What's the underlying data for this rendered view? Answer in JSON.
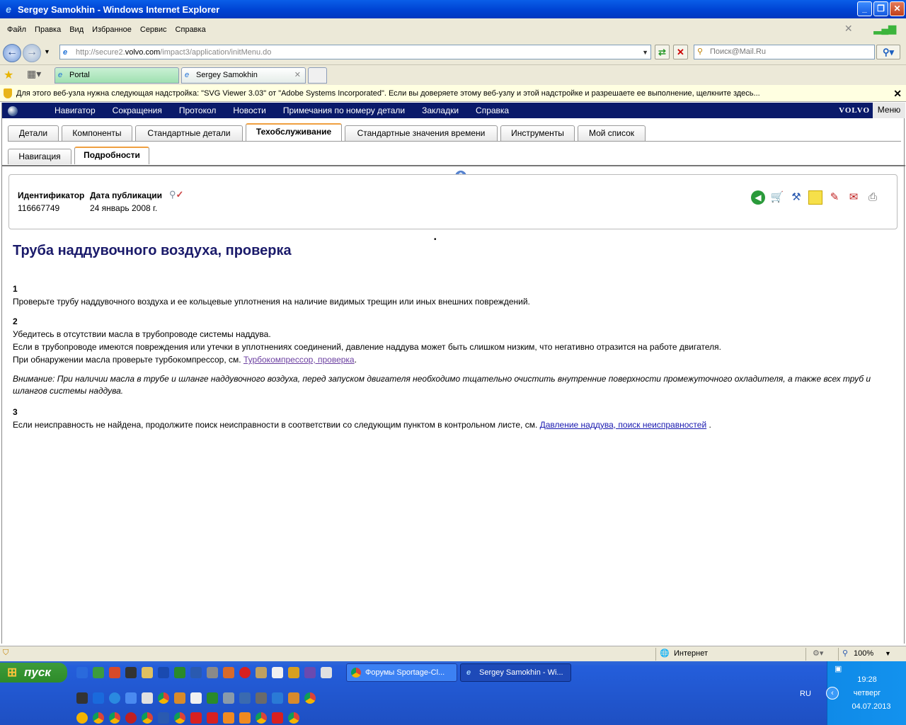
{
  "window": {
    "title": "Sergey Samokhin - Windows Internet Explorer"
  },
  "menu": [
    "Файл",
    "Правка",
    "Вид",
    "Избранное",
    "Сервис",
    "Справка"
  ],
  "address": {
    "prefix": "http://secure2.",
    "host": "volvo.com",
    "path": "/impact3/application/initMenu.do"
  },
  "search": {
    "placeholder": "Поиск@Mail.Ru"
  },
  "browser_tabs": [
    {
      "label": "Portal"
    },
    {
      "label": "Sergey Samokhin"
    }
  ],
  "infobar": {
    "text": "Для этого веб-узла нужна следующая надстройка: \"SVG Viewer 3.03\" от \"Adobe Systems Incorporated\". Если вы доверяете этому веб-узлу и этой надстройке и разрешаете ее выполнение, щелкните здесь..."
  },
  "vnav": {
    "items": [
      "Навигатор",
      "Сокращения",
      "Протокол",
      "Новости",
      "Примечания по номеру детали",
      "Закладки",
      "Справка"
    ],
    "brand": "VOLVO",
    "menu_label": "Меню"
  },
  "tabs_main": [
    "Детали",
    "Компоненты",
    "Стандартные детали",
    "Техобслуживание",
    "Стандартные значения времени",
    "Инструменты",
    "Мой список"
  ],
  "tabs_sub": [
    "Навигация",
    "Подробности"
  ],
  "meta": {
    "id_label": "Идентификатор",
    "id_value": "116667749",
    "date_label": "Дата публикации",
    "date_value": "24 январь 2008 г."
  },
  "article": {
    "title": "Труба наддувочного воздуха, проверка",
    "s1_num": "1",
    "s1_text": "Проверьте трубу наддувочного воздуха и ее кольцевые уплотнения на наличие видимых трещин или иных внешних повреждений.",
    "s2_num": "2",
    "s2_l1": "Убедитесь в отсутствии масла в трубопроводе системы наддува.",
    "s2_l2": "Если в трубопроводе имеются повреждения или утечки в уплотнениях соединений, давление наддува может быть слишком низким, что негативно отразится на работе двигателя.",
    "s2_l3": "При обнаружении масла проверьте турбокомпрессор, см.",
    "s2_link": "Турбокомпрессор, проверка",
    "note": "Внимание: При наличии масла в трубе и шланге наддувочного воздуха, перед запуском двигателя необходимо тщательно очистить внутренние поверхности промежуточного охладителя, а также всех труб и шлангов системы наддува.",
    "s3_num": "3",
    "s3_text": "Если неисправность не найдена, продолжите поиск неисправности в соответствии со следующим пунктом в контрольном листе, см.",
    "s3_link": "Давление наддува, поиск неисправностей"
  },
  "status": {
    "zone": "Интернет",
    "zoom": "100%"
  },
  "taskbar": {
    "start": "пуск",
    "tasks": [
      "Форумы Sportage-Cl...",
      "Sergey Samokhin - Wi..."
    ],
    "lang": "RU",
    "time": "19:28",
    "day": "четверг",
    "date": "04.07.2013"
  }
}
